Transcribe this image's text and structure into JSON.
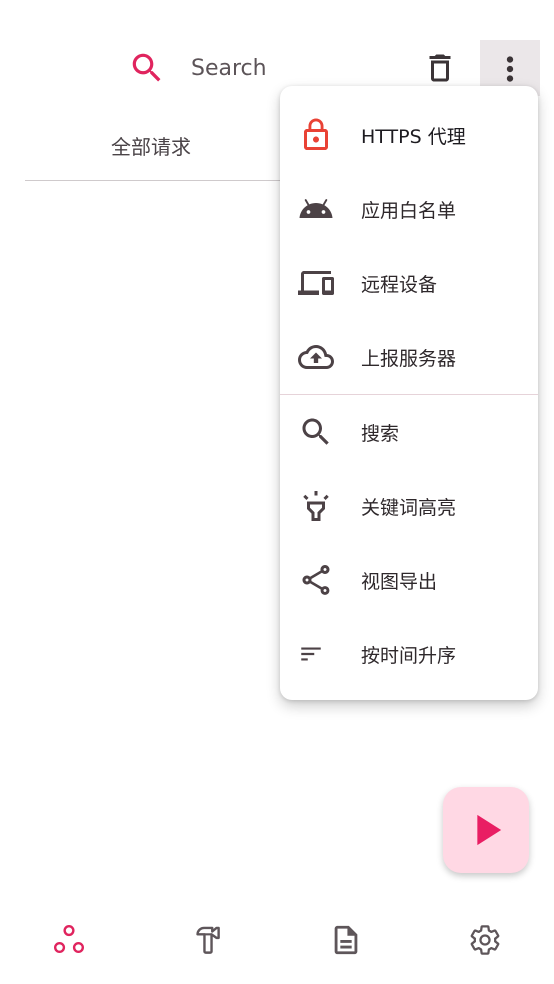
{
  "colors": {
    "accent": "#e0245e",
    "fab_background": "#ffd8e4",
    "lock_icon": "#e94235",
    "menu_icon": "#4c4246",
    "nav_icon": "#5e565a"
  },
  "top_bar": {
    "search_icon": "search-icon",
    "search_placeholder": "Search",
    "delete_icon": "delete-icon",
    "more_icon": "more-vert-icon"
  },
  "tabs": [
    {
      "label": "全部请求"
    }
  ],
  "menu": {
    "items": [
      {
        "icon": "lock-icon",
        "label": "HTTPS 代理"
      },
      {
        "icon": "android-icon",
        "label": "应用白名单"
      },
      {
        "icon": "devices-icon",
        "label": "远程设备"
      },
      {
        "icon": "cloud-upload-icon",
        "label": "上报服务器"
      },
      {
        "icon": "search-icon",
        "label": "搜索"
      },
      {
        "icon": "highlight-icon",
        "label": "关键词高亮"
      },
      {
        "icon": "share-icon",
        "label": "视图导出"
      },
      {
        "icon": "sort-icon",
        "label": "按时间升序"
      }
    ]
  },
  "fab": {
    "icon": "play-icon"
  },
  "bottom_nav": [
    {
      "icon": "bubbles-icon",
      "selected": true
    },
    {
      "icon": "hammer-icon",
      "selected": false
    },
    {
      "icon": "document-icon",
      "selected": false
    },
    {
      "icon": "settings-icon",
      "selected": false
    }
  ]
}
